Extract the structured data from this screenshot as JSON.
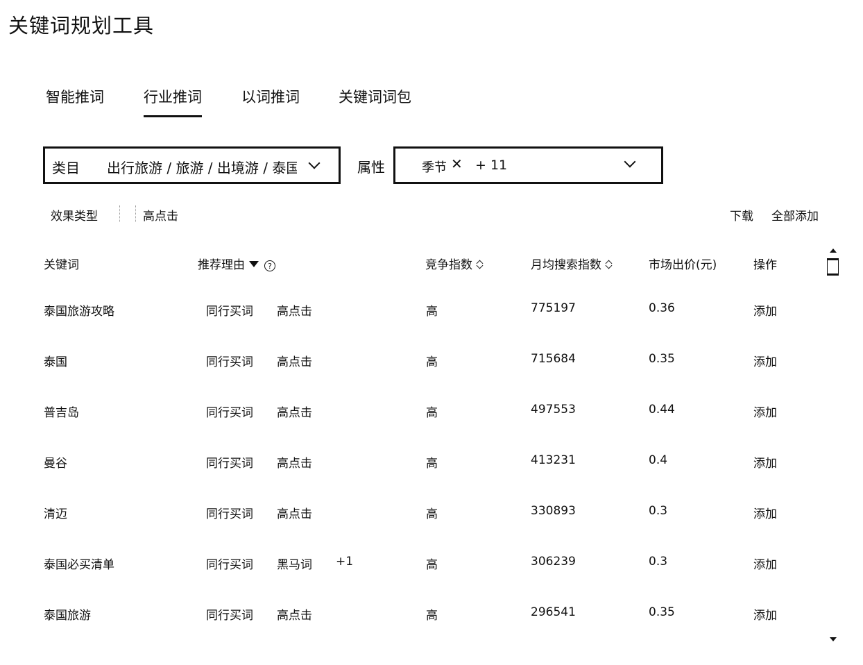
{
  "page": {
    "title": "关键词规划工具"
  },
  "tabs": [
    {
      "label": "智能推词"
    },
    {
      "label": "行业推词",
      "active": true
    },
    {
      "label": "以词推词"
    },
    {
      "label": "关键词词包"
    }
  ],
  "filters": {
    "category": {
      "label": "类目",
      "value": "出行旅游 / 旅游 / 出境游 / 泰国"
    },
    "attribute": {
      "label": "属性",
      "tags": [
        "季节"
      ],
      "more": "+ 11"
    },
    "effect": {
      "label": "效果类型",
      "value": "高点击"
    }
  },
  "actions": {
    "download": "下载",
    "add_all": "全部添加"
  },
  "table": {
    "columns": {
      "keyword": "关键词",
      "reason": "推荐理由",
      "competition": "竞争指数",
      "monthly_search": "月均搜索指数",
      "market_bid": "市场出价(元)",
      "operation": "操作"
    },
    "rows": [
      {
        "keyword": "泰国旅游攻略",
        "reasons": [
          "同行买词",
          "高点击"
        ],
        "extra": "",
        "competition": "高",
        "monthly_search": "775197",
        "bid": "0.36",
        "op": "添加"
      },
      {
        "keyword": "泰国",
        "reasons": [
          "同行买词",
          "高点击"
        ],
        "extra": "",
        "competition": "高",
        "monthly_search": "715684",
        "bid": "0.35",
        "op": "添加"
      },
      {
        "keyword": "普吉岛",
        "reasons": [
          "同行买词",
          "高点击"
        ],
        "extra": "",
        "competition": "高",
        "monthly_search": "497553",
        "bid": "0.44",
        "op": "添加"
      },
      {
        "keyword": "曼谷",
        "reasons": [
          "同行买词",
          "高点击"
        ],
        "extra": "",
        "competition": "高",
        "monthly_search": "413231",
        "bid": "0.4",
        "op": "添加"
      },
      {
        "keyword": "清迈",
        "reasons": [
          "同行买词",
          "高点击"
        ],
        "extra": "",
        "competition": "高",
        "monthly_search": "330893",
        "bid": "0.3",
        "op": "添加"
      },
      {
        "keyword": "泰国必买清单",
        "reasons": [
          "同行买词",
          "黑马词"
        ],
        "extra": "+1",
        "competition": "高",
        "monthly_search": "306239",
        "bid": "0.3",
        "op": "添加"
      },
      {
        "keyword": "泰国旅游",
        "reasons": [
          "同行买词",
          "高点击"
        ],
        "extra": "",
        "competition": "高",
        "monthly_search": "296541",
        "bid": "0.35",
        "op": "添加"
      }
    ]
  },
  "icons": {
    "chevron": "chevron-down-icon",
    "close": "close-icon",
    "filter": "filter-icon",
    "help": "help-icon",
    "sort": "sort-icon"
  }
}
